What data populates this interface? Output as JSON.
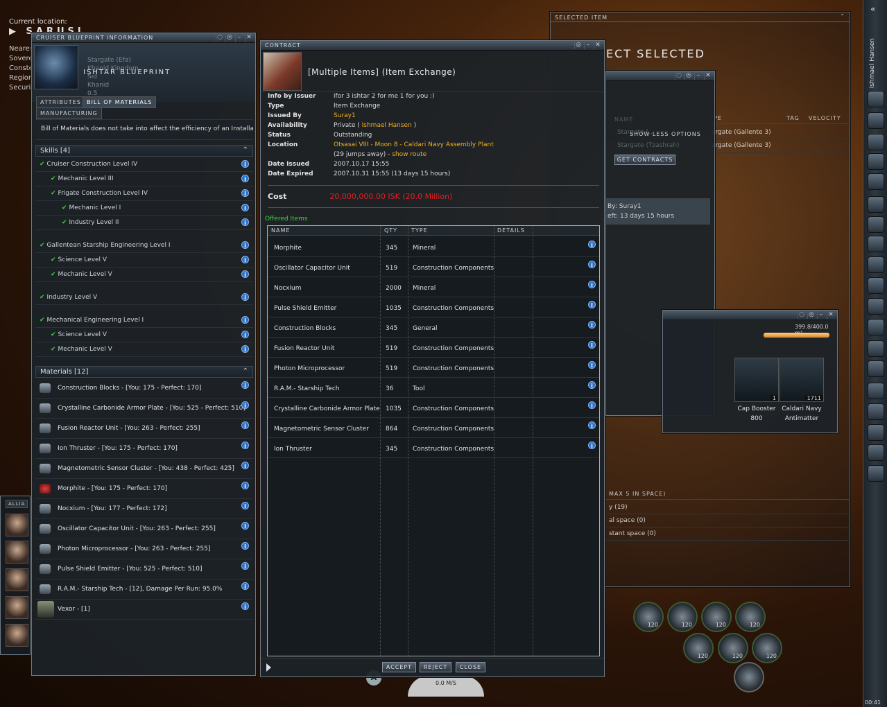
{
  "location": {
    "label": "Current location:",
    "system": "SARUSI"
  },
  "left_labels": [
    "Neares",
    "Sovere",
    "Conste",
    "Region",
    "Securi"
  ],
  "blueprint": {
    "window_title": "CRUISER BLUEPRINT INFORMATION",
    "sub_lines": [
      "Stargate (Efa)",
      "Khanid Kingdom",
      "Sid",
      "Khanid",
      "0.5"
    ],
    "name": "ISHTAR BLUEPRINT",
    "tabs": [
      "ATTRIBUTES",
      "BILL OF MATERIALS"
    ],
    "active_tab": "MANUFACTURING",
    "note": "Bill of Materials does not take into affect the efficiency of an Installation",
    "skills_header": "Skills [4]",
    "skills": [
      "Cruiser Construction Level IV",
      "Mechanic Level III",
      "Frigate Construction Level IV",
      "Mechanic Level I",
      "Industry Level II",
      "Gallentean Starship Engineering Level I",
      "Science Level V",
      "Mechanic Level V",
      "Industry Level V",
      "Mechanical Engineering Level I",
      "Science Level V",
      "Mechanic Level V"
    ],
    "materials_header": "Materials [12]",
    "materials": [
      "Construction Blocks - [You: 175 - Perfect: 170]",
      "Crystalline Carbonide Armor Plate - [You: 525 - Perfect: 510]",
      "Fusion Reactor Unit - [You: 263 - Perfect: 255]",
      "Ion Thruster - [You: 175 - Perfect: 170]",
      "Magnetometric Sensor Cluster - [You: 438 - Perfect: 425]",
      "Morphite - [You: 175 - Perfect: 170]",
      "Nocxium - [You: 177 - Perfect: 172]",
      "Oscillator Capacitor Unit - [You: 263 - Perfect: 255]",
      "Photon Microprocessor - [You: 263 - Perfect: 255]",
      "Pulse Shield Emitter - [You: 525 - Perfect: 510]",
      "R.A.M.- Starship Tech - [12], Damage Per Run: 95.0%",
      "Vexor - [1]"
    ]
  },
  "contract": {
    "window_title": "CONTRACT",
    "title": "[Multiple Items] (Item Exchange)",
    "fields": {
      "info_by_issuer_label": "Info by Issuer",
      "info_by_issuer": "ifor 3 ishtar 2 for me 1 for you :)",
      "type_label": "Type",
      "type": "Item Exchange",
      "issued_by_label": "Issued By",
      "issued_by": "Suray1",
      "availability_label": "Availability",
      "availability_prefix": "Private (",
      "availability_name": "Ishmael Hansen",
      "availability_suffix": ")",
      "status_label": "Status",
      "status": "Outstanding",
      "location_label": "Location",
      "location": "Otsasai VIII - Moon 8 - Caldari Navy Assembly Plant",
      "jumps": "(29 jumps away) -",
      "show_route": "show route",
      "date_issued_label": "Date Issued",
      "date_issued": "2007.10.17 15:55",
      "date_expired_label": "Date Expired",
      "date_expired": "2007.10.31 15:55 (13 days 15 hours)"
    },
    "cost_label": "Cost",
    "cost": "20,000,000.00 ISK (20.0 Million)",
    "offered_label": "Offered Items",
    "columns": [
      "NAME",
      "QTY",
      "TYPE",
      "DETAILS"
    ],
    "items": [
      {
        "name": "Morphite",
        "qty": "345",
        "type": "Mineral"
      },
      {
        "name": "Oscillator Capacitor Unit",
        "qty": "519",
        "type": "Construction Components"
      },
      {
        "name": "Nocxium",
        "qty": "2000",
        "type": "Mineral"
      },
      {
        "name": "Pulse Shield Emitter",
        "qty": "1035",
        "type": "Construction Components"
      },
      {
        "name": "Construction Blocks",
        "qty": "345",
        "type": "General"
      },
      {
        "name": "Fusion Reactor Unit",
        "qty": "519",
        "type": "Construction Components"
      },
      {
        "name": "Photon Microprocessor",
        "qty": "519",
        "type": "Construction Components"
      },
      {
        "name": "R.A.M.- Starship Tech",
        "qty": "36",
        "type": "Tool"
      },
      {
        "name": "Crystalline Carbonide Armor Plate",
        "qty": "1035",
        "type": "Construction Components"
      },
      {
        "name": "Magnetometric Sensor Cluster",
        "qty": "864",
        "type": "Construction Components"
      },
      {
        "name": "Ion Thruster",
        "qty": "345",
        "type": "Construction Components"
      }
    ],
    "buttons": {
      "accept": "ACCEPT",
      "reject": "REJECT",
      "close": "CLOSE"
    }
  },
  "selected_item": {
    "title": "SELECTED ITEM",
    "big": "ECT SELECTED",
    "overview_cols": [
      "PE",
      "TAG",
      "VELOCITY"
    ],
    "overview_rows": [
      "argate (Gallente 3)",
      "argate (Gallente 3)"
    ],
    "max_label": "MAX 5 IN SPACE)",
    "sections": [
      "y (19)",
      "al space (0)",
      "stant space (0)"
    ]
  },
  "finder": {
    "name_col": "NAME",
    "ghost_rows": [
      "Stargate (...",
      "Stargate (Tzashrah)"
    ],
    "show_less": "SHOW LESS OPTIONS",
    "get_contracts": "GET CONTRACTS",
    "by": "By: Suray1",
    "left": "eft: 13 days 15 hours"
  },
  "cargo": {
    "capacity": "399.8/400.0 m³",
    "fill": 0.9995,
    "items": [
      {
        "label1": "Cap Booster",
        "label2": "800",
        "qty": "1"
      },
      {
        "label1": "Caldari Navy",
        "label2": "Antimatter",
        "qty": "1711"
      }
    ]
  },
  "neocom": {
    "character": "Ishmael Hansen",
    "clock": "00:41"
  },
  "chat": {
    "tab": "ALLIA"
  },
  "hud": {
    "speed": "0.0 M/S",
    "ammo": "120",
    "letter": "A"
  }
}
